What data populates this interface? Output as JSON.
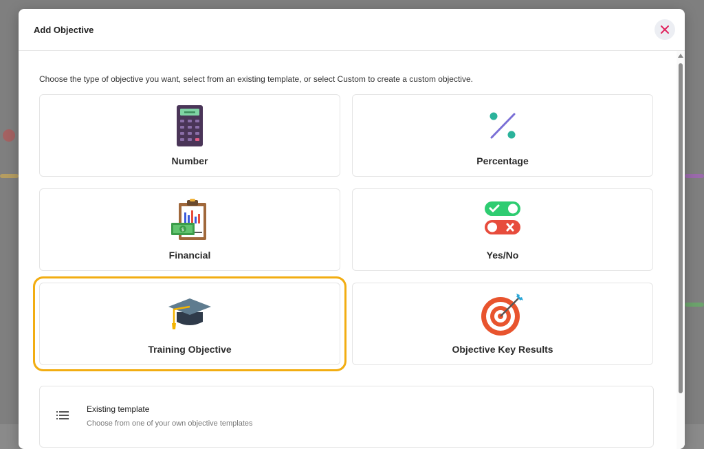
{
  "dialog": {
    "title": "Add Objective",
    "intro": "Choose the type of objective you want, select from an existing template, or select Custom to create a custom objective."
  },
  "objective_types": [
    {
      "label": "Number",
      "icon": "calculator-icon"
    },
    {
      "label": "Percentage",
      "icon": "percent-icon"
    },
    {
      "label": "Financial",
      "icon": "financial-clipboard-icon"
    },
    {
      "label": "Yes/No",
      "icon": "toggle-switches-icon"
    },
    {
      "label": "Training Objective",
      "icon": "graduation-cap-icon",
      "selected": true
    },
    {
      "label": "Objective Key Results",
      "icon": "target-icon"
    }
  ],
  "existing_template": {
    "title": "Existing template",
    "description": "Choose from one of your own objective templates",
    "icon": "list-icon"
  },
  "colors": {
    "selected_outline": "#f2ad12",
    "close_icon": "#e0245e",
    "teal": "#2bb39b",
    "red": "#e74c3c",
    "green": "#2ecc71"
  }
}
